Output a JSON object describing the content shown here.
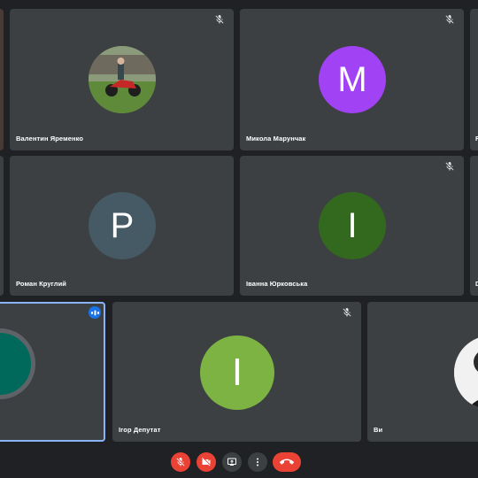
{
  "participants": [
    {
      "name": "Валентин Яременко",
      "muted": true,
      "avatar": "photo"
    },
    {
      "name": "Микола Марунчак",
      "muted": true,
      "initial": "M",
      "color": "#a142f4"
    },
    {
      "name": "Роман Круглий",
      "muted": false,
      "initial": "P",
      "color": "#455a64"
    },
    {
      "name": "Іванна Юрковська",
      "muted": true,
      "initial": "I",
      "color": "#33691e"
    },
    {
      "name": "Ігор Депутат",
      "muted": true,
      "initial": "I",
      "color": "#7cb342"
    },
    {
      "name": "Ви",
      "muted": false,
      "avatar": "photo"
    }
  ],
  "partial_tiles": {
    "right_name_fragments": [
      "F",
      "D"
    ]
  },
  "controls": {
    "mic": "mic-off-icon",
    "camera": "camera-off-icon",
    "present": "present-screen-icon",
    "more": "more-vert-icon",
    "hangup": "hangup-icon"
  },
  "colors": {
    "background": "#202124",
    "tile": "#3c4043",
    "speaking_border": "#8ab4f8",
    "danger": "#ea4335",
    "speaking_badge": "#1a73e8"
  }
}
